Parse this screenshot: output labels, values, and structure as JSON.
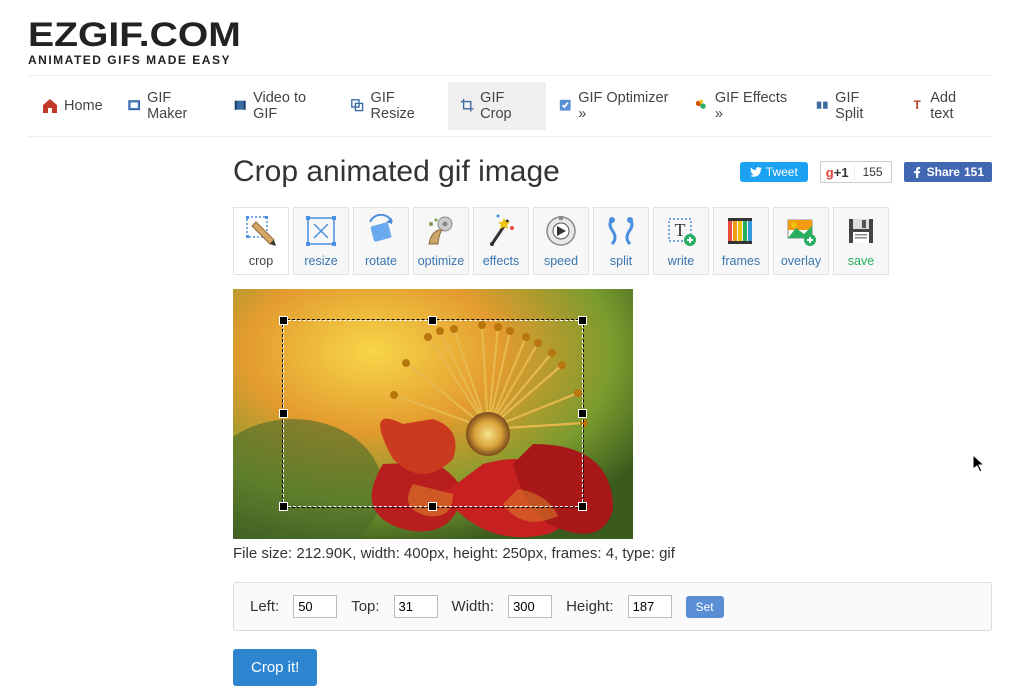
{
  "logo": {
    "title": "EZGIF.COM",
    "subtitle": "ANIMATED GIFS MADE EASY"
  },
  "nav": {
    "home": "Home",
    "maker": "GIF Maker",
    "video": "Video to GIF",
    "resize": "GIF Resize",
    "crop": "GIF Crop",
    "optimizer": "GIF Optimizer »",
    "effects": "GIF Effects »",
    "split": "GIF Split",
    "addtext": "Add text"
  },
  "share": {
    "tweet": "Tweet",
    "gplus_count": "155",
    "fb": "Share",
    "fb_count": "151"
  },
  "page": {
    "title": "Crop animated gif image"
  },
  "tools": {
    "crop": "crop",
    "resize": "resize",
    "rotate": "rotate",
    "optimize": "optimize",
    "effects": "effects",
    "speed": "speed",
    "split": "split",
    "write": "write",
    "frames": "frames",
    "overlay": "overlay",
    "save": "save"
  },
  "image_info": "File size: 212.90K, width: 400px, height: 250px, frames: 4, type: gif",
  "crop": {
    "left": "50",
    "top": "31",
    "width": "300",
    "height": "187"
  },
  "labels": {
    "left": "Left:",
    "top": "Top:",
    "width": "Width:",
    "height": "Height:",
    "set": "Set",
    "cropit": "Crop it!"
  }
}
